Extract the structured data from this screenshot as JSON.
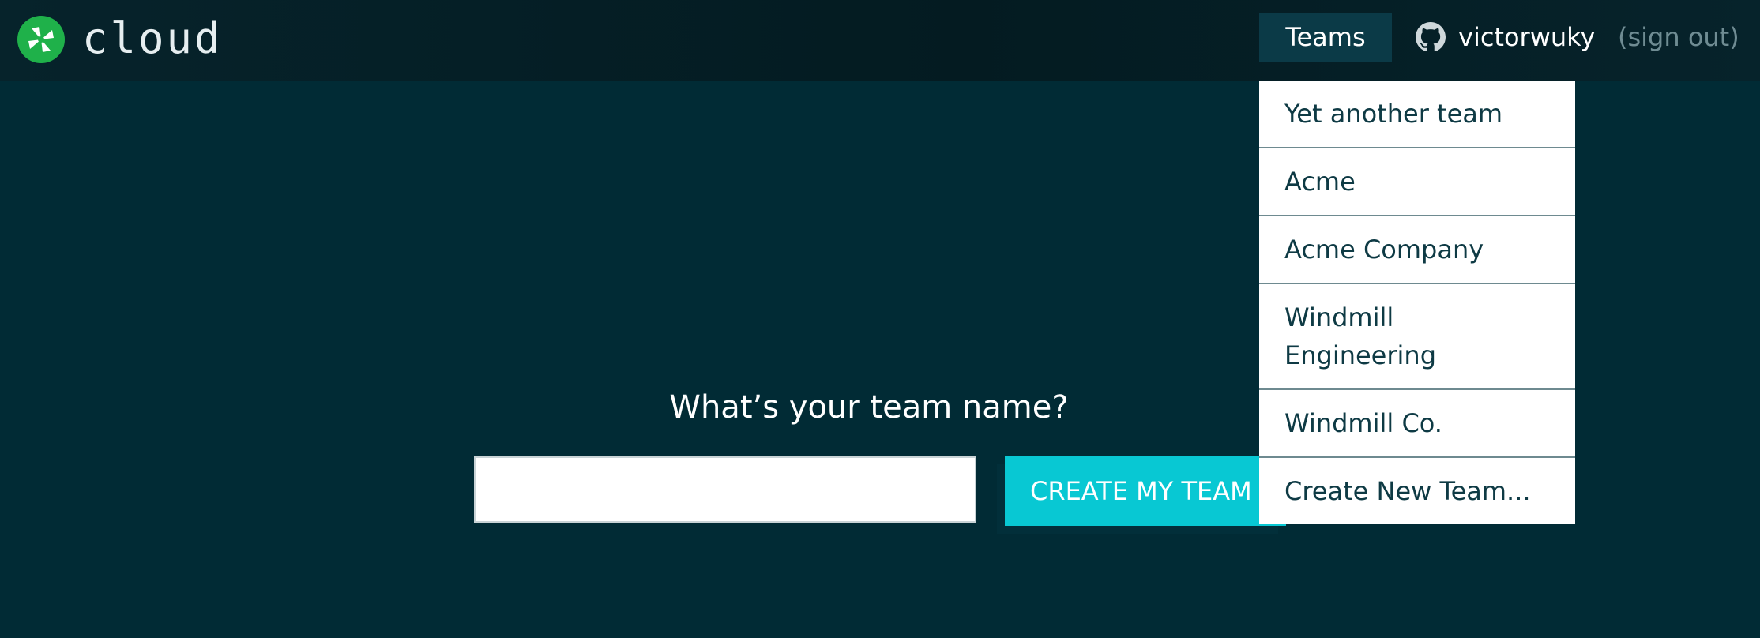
{
  "header": {
    "brand": "cloud",
    "teams_label": "Teams",
    "username": "victorwuky",
    "sign_out": "(sign out)",
    "icons": {
      "logo": "windmill-logo-icon",
      "github": "github-icon"
    }
  },
  "main": {
    "question": "What’s your team name?",
    "input_value": "",
    "create_button": "CREATE MY TEAM"
  },
  "teams_dropdown": {
    "items": [
      {
        "label": "Yet another team"
      },
      {
        "label": "Acme"
      },
      {
        "label": "Acme Company"
      },
      {
        "label": "Windmill Engineering"
      },
      {
        "label": "Windmill Co."
      },
      {
        "label": "Create New Team..."
      }
    ]
  },
  "colors": {
    "background": "#012b35",
    "header": "#041b21",
    "accent": "#08c8d3",
    "logo_green": "#1fb14a",
    "teams_button": "#0b3a47",
    "dropdown_text": "#0e3a44",
    "signout_text": "#6f8c93"
  }
}
